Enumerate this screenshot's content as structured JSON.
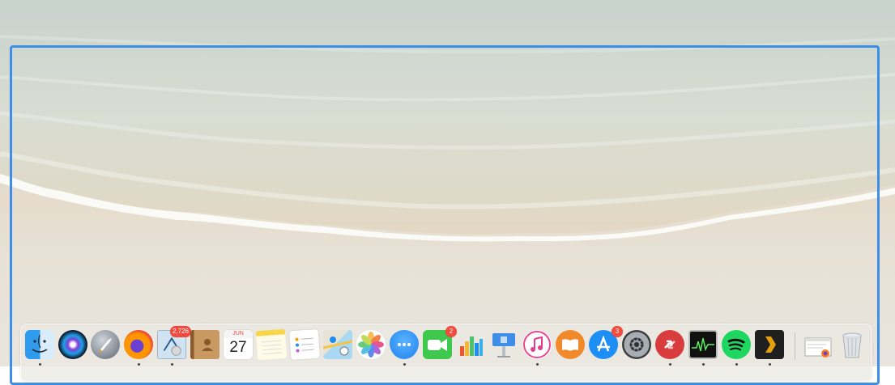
{
  "desktop": {
    "wallpaper": "beach-shore",
    "selection_color": "#3d8de9"
  },
  "dock": {
    "items": [
      {
        "name": "Finder",
        "icon": "finder-icon",
        "running": true
      },
      {
        "name": "Siri",
        "icon": "siri-icon",
        "running": false
      },
      {
        "name": "Launchpad",
        "icon": "launchpad-icon",
        "running": false
      },
      {
        "name": "Firefox",
        "icon": "firefox-icon",
        "running": true
      },
      {
        "name": "Mail",
        "icon": "mail-icon",
        "running": true,
        "badge": "2,726"
      },
      {
        "name": "Contacts",
        "icon": "contacts-icon",
        "running": false
      },
      {
        "name": "Calendar",
        "icon": "calendar-icon",
        "running": false,
        "month": "JUN",
        "day": "27"
      },
      {
        "name": "Notes",
        "icon": "notes-icon",
        "running": false
      },
      {
        "name": "Reminders",
        "icon": "reminders-icon",
        "running": false
      },
      {
        "name": "Maps",
        "icon": "maps-icon",
        "running": false
      },
      {
        "name": "Photos",
        "icon": "photos-icon",
        "running": false
      },
      {
        "name": "Messages",
        "icon": "messages-icon",
        "running": true
      },
      {
        "name": "FaceTime",
        "icon": "facetime-icon",
        "running": false,
        "badge": "2"
      },
      {
        "name": "Numbers",
        "icon": "numbers-icon",
        "running": false
      },
      {
        "name": "Keynote",
        "icon": "keynote-icon",
        "running": false
      },
      {
        "name": "iTunes",
        "icon": "itunes-icon",
        "running": true
      },
      {
        "name": "Books",
        "icon": "books-icon",
        "running": false
      },
      {
        "name": "App Store",
        "icon": "app-store-icon",
        "running": false,
        "badge": "3"
      },
      {
        "name": "System Preferences",
        "icon": "system-preferences-icon",
        "running": false
      },
      {
        "name": "Remote Desktop",
        "icon": "remote-desktop-icon",
        "running": true
      },
      {
        "name": "Activity Monitor",
        "icon": "activity-monitor-icon",
        "running": true
      },
      {
        "name": "Spotify",
        "icon": "spotify-icon",
        "running": true
      },
      {
        "name": "Plex",
        "icon": "plex-icon",
        "running": true
      },
      {
        "name": "Downloads",
        "icon": "downloads-stack-icon",
        "running": false
      },
      {
        "name": "Trash",
        "icon": "trash-icon",
        "running": false
      }
    ]
  }
}
